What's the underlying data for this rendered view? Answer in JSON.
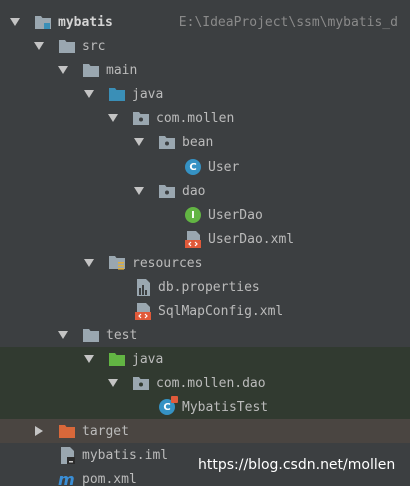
{
  "tree": {
    "root": {
      "label": "mybatis",
      "path": "E:\\IdeaProject\\ssm\\mybatis_d"
    },
    "src": "src",
    "main": "main",
    "java_main": "java",
    "pkg_mollen": "com.mollen",
    "bean": "bean",
    "user": "User",
    "dao": "dao",
    "userdao": "UserDao",
    "userdao_xml": "UserDao.xml",
    "resources": "resources",
    "db_properties": "db.properties",
    "sqlmapconfig": "SqlMapConfig.xml",
    "test": "test",
    "java_test": "java",
    "pkg_dao": "com.mollen.dao",
    "mybatistest": "MybatisTest",
    "target": "target",
    "mybatis_iml": "mybatis.iml",
    "pom_xml": "pom.xml"
  },
  "watermark": "https://blog.csdn.net/mollen",
  "colors": {
    "background": "#3c3f41",
    "test_section": "#313a30",
    "target_row": "#4a4541",
    "folder": "#9aa7b0",
    "source_folder": "#3a8fb7",
    "test_folder": "#62b543",
    "target_folder": "#d9683a",
    "class_badge": "#3592c4",
    "interface_badge": "#62b543",
    "xml_icon": "#e05a3a"
  }
}
